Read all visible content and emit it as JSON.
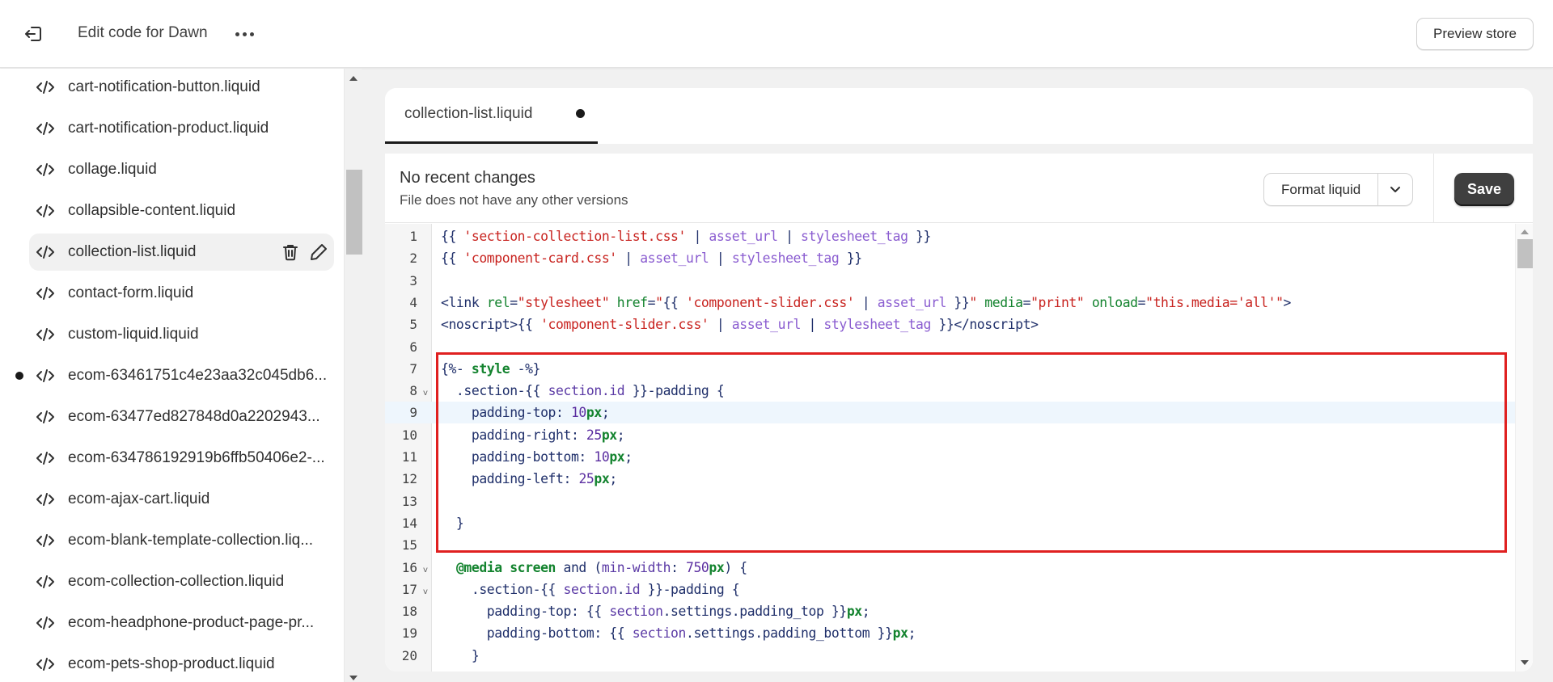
{
  "header": {
    "exit_icon": "exit-icon",
    "title": "Edit code for Dawn",
    "more_icon": "more-horizontal-icon",
    "preview_label": "Preview store"
  },
  "sidebar": {
    "files": [
      {
        "name": "cart-notification-button.liquid",
        "icon": "code-icon",
        "active": false,
        "modified": false
      },
      {
        "name": "cart-notification-product.liquid",
        "icon": "code-icon",
        "active": false,
        "modified": false
      },
      {
        "name": "collage.liquid",
        "icon": "code-icon",
        "active": false,
        "modified": false
      },
      {
        "name": "collapsible-content.liquid",
        "icon": "code-icon",
        "active": false,
        "modified": false
      },
      {
        "name": "collection-list.liquid",
        "icon": "code-icon",
        "active": true,
        "modified": false
      },
      {
        "name": "contact-form.liquid",
        "icon": "code-icon",
        "active": false,
        "modified": false
      },
      {
        "name": "custom-liquid.liquid",
        "icon": "code-icon",
        "active": false,
        "modified": false
      },
      {
        "name": "ecom-63461751c4e23aa32c045db6...",
        "icon": "code-icon",
        "active": false,
        "modified": true
      },
      {
        "name": "ecom-63477ed827848d0a2202943...",
        "icon": "code-icon",
        "active": false,
        "modified": false
      },
      {
        "name": "ecom-634786192919b6ffb50406e2-...",
        "icon": "code-icon",
        "active": false,
        "modified": false
      },
      {
        "name": "ecom-ajax-cart.liquid",
        "icon": "code-icon",
        "active": false,
        "modified": false
      },
      {
        "name": "ecom-blank-template-collection.liq...",
        "icon": "code-icon",
        "active": false,
        "modified": false
      },
      {
        "name": "ecom-collection-collection.liquid",
        "icon": "code-icon",
        "active": false,
        "modified": false
      },
      {
        "name": "ecom-headphone-product-page-pr...",
        "icon": "code-icon",
        "active": false,
        "modified": false
      },
      {
        "name": "ecom-pets-shop-product.liquid",
        "icon": "code-icon",
        "active": false,
        "modified": false
      }
    ],
    "active_actions": {
      "delete_icon": "trash-icon",
      "rename_icon": "pencil-icon"
    }
  },
  "editor": {
    "tab": {
      "label": "collection-list.liquid",
      "unsaved": true
    },
    "status": {
      "title": "No recent changes",
      "subtitle": "File does not have any other versions"
    },
    "format_label": "Format liquid",
    "save_label": "Save",
    "current_line": 9,
    "highlight_lines": [
      7,
      15
    ],
    "highlight_color": "#e02020",
    "lines": [
      {
        "n": "1",
        "fold": false,
        "tokens": [
          [
            "p",
            "{{ "
          ],
          [
            "s",
            "'section-collection-list.css'"
          ],
          [
            "p",
            " | "
          ],
          [
            "f",
            "asset_url"
          ],
          [
            "p",
            " | "
          ],
          [
            "f",
            "stylesheet_tag"
          ],
          [
            "p",
            " }}"
          ]
        ]
      },
      {
        "n": "2",
        "fold": false,
        "tokens": [
          [
            "p",
            "{{ "
          ],
          [
            "s",
            "'component-card.css'"
          ],
          [
            "p",
            " | "
          ],
          [
            "f",
            "asset_url"
          ],
          [
            "p",
            " | "
          ],
          [
            "f",
            "stylesheet_tag"
          ],
          [
            "p",
            " }}"
          ]
        ]
      },
      {
        "n": "3",
        "fold": false,
        "tokens": []
      },
      {
        "n": "4",
        "fold": false,
        "tokens": [
          [
            "p",
            "<link "
          ],
          [
            "a",
            "rel"
          ],
          [
            "p",
            "="
          ],
          [
            "s",
            "\"stylesheet\""
          ],
          [
            "p",
            " "
          ],
          [
            "a",
            "href"
          ],
          [
            "p",
            "="
          ],
          [
            "s",
            "\""
          ],
          [
            "p",
            "{{ "
          ],
          [
            "s",
            "'component-slider.css'"
          ],
          [
            "p",
            " | "
          ],
          [
            "f",
            "asset_url"
          ],
          [
            "p",
            " }}"
          ],
          [
            "s",
            "\""
          ],
          [
            "p",
            " "
          ],
          [
            "a",
            "media"
          ],
          [
            "p",
            "="
          ],
          [
            "s",
            "\"print\""
          ],
          [
            "p",
            " "
          ],
          [
            "a",
            "onload"
          ],
          [
            "p",
            "="
          ],
          [
            "s",
            "\"this.media='all'\""
          ],
          [
            "p",
            ">"
          ]
        ]
      },
      {
        "n": "5",
        "fold": false,
        "tokens": [
          [
            "p",
            "<noscript>{{ "
          ],
          [
            "s",
            "'component-slider.css'"
          ],
          [
            "p",
            " | "
          ],
          [
            "f",
            "asset_url"
          ],
          [
            "p",
            " | "
          ],
          [
            "f",
            "stylesheet_tag"
          ],
          [
            "p",
            " }}</noscript>"
          ]
        ]
      },
      {
        "n": "6",
        "fold": false,
        "tokens": []
      },
      {
        "n": "7",
        "fold": false,
        "tokens": [
          [
            "p",
            "{%- "
          ],
          [
            "k",
            "style"
          ],
          [
            "p",
            " -%}"
          ]
        ]
      },
      {
        "n": "8",
        "fold": true,
        "tokens": [
          [
            "p",
            "  .section-"
          ],
          [
            "p",
            "{{ "
          ],
          [
            "v",
            "section.id"
          ],
          [
            "p",
            " }}"
          ],
          [
            "p",
            "-padding {"
          ]
        ]
      },
      {
        "n": "9",
        "fold": false,
        "tokens": [
          [
            "p",
            "    padding-top: "
          ],
          [
            "n",
            "10"
          ],
          [
            "u",
            "px"
          ],
          [
            "p",
            ";"
          ]
        ]
      },
      {
        "n": "10",
        "fold": false,
        "tokens": [
          [
            "p",
            "    padding-right: "
          ],
          [
            "n",
            "25"
          ],
          [
            "u",
            "px"
          ],
          [
            "p",
            ";"
          ]
        ]
      },
      {
        "n": "11",
        "fold": false,
        "tokens": [
          [
            "p",
            "    padding-bottom: "
          ],
          [
            "n",
            "10"
          ],
          [
            "u",
            "px"
          ],
          [
            "p",
            ";"
          ]
        ]
      },
      {
        "n": "12",
        "fold": false,
        "tokens": [
          [
            "p",
            "    padding-left: "
          ],
          [
            "n",
            "25"
          ],
          [
            "u",
            "px"
          ],
          [
            "p",
            ";"
          ]
        ]
      },
      {
        "n": "13",
        "fold": false,
        "tokens": []
      },
      {
        "n": "14",
        "fold": false,
        "tokens": [
          [
            "p",
            "  }"
          ]
        ]
      },
      {
        "n": "15",
        "fold": false,
        "tokens": []
      },
      {
        "n": "16",
        "fold": true,
        "tokens": [
          [
            "p",
            "  "
          ],
          [
            "k",
            "@media"
          ],
          [
            "p",
            " "
          ],
          [
            "k",
            "screen"
          ],
          [
            "p",
            " and ("
          ],
          [
            "v",
            "min-width"
          ],
          [
            "p",
            ": "
          ],
          [
            "n",
            "750"
          ],
          [
            "u",
            "px"
          ],
          [
            "p",
            ") {"
          ]
        ]
      },
      {
        "n": "17",
        "fold": true,
        "tokens": [
          [
            "p",
            "    .section-"
          ],
          [
            "p",
            "{{ "
          ],
          [
            "v",
            "section"
          ],
          [
            "p",
            "."
          ],
          [
            "v",
            "id"
          ],
          [
            "p",
            " }}"
          ],
          [
            "p",
            "-padding {"
          ]
        ]
      },
      {
        "n": "18",
        "fold": false,
        "tokens": [
          [
            "p",
            "      padding-top: "
          ],
          [
            "p",
            "{{ "
          ],
          [
            "v",
            "section"
          ],
          [
            "p",
            ".settings.padding_top }}"
          ],
          [
            "u",
            "px"
          ],
          [
            "p",
            ";"
          ]
        ]
      },
      {
        "n": "19",
        "fold": false,
        "tokens": [
          [
            "p",
            "      padding-bottom: "
          ],
          [
            "p",
            "{{ "
          ],
          [
            "v",
            "section"
          ],
          [
            "p",
            ".settings.padding_bottom }}"
          ],
          [
            "u",
            "px"
          ],
          [
            "p",
            ";"
          ]
        ]
      },
      {
        "n": "20",
        "fold": false,
        "tokens": [
          [
            "p",
            "    }"
          ]
        ]
      }
    ]
  }
}
